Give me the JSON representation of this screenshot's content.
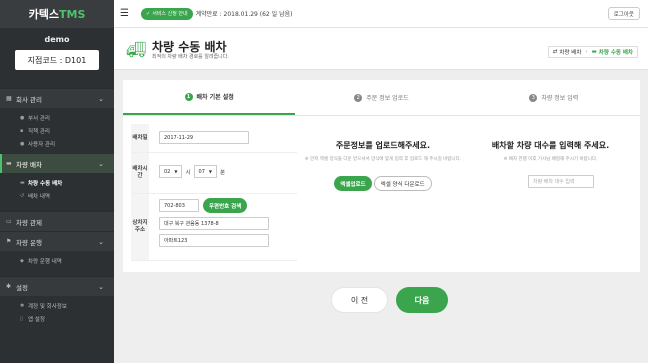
{
  "brand": {
    "name": "카텍스",
    "suffix": "TMS"
  },
  "user": {
    "name": "demo",
    "branch_code": "지점코드 : D101"
  },
  "sidebar": {
    "sections": [
      {
        "label": "회사 관리",
        "icon": "building-icon",
        "items": [
          {
            "label": "부서 관리",
            "icon": "people-icon"
          },
          {
            "label": "직책 관리",
            "icon": "id-card-icon"
          },
          {
            "label": "사용자 관리",
            "icon": "user-icon"
          }
        ]
      },
      {
        "label": "차량 배차",
        "icon": "truck-icon",
        "items": [
          {
            "label": "차량 수동 배차",
            "icon": "truck-icon"
          },
          {
            "label": "배차 내역",
            "icon": "history-icon"
          }
        ]
      },
      {
        "label": "차량 관제",
        "icon": "monitor-icon"
      },
      {
        "label": "차량 운행",
        "icon": "route-icon",
        "items": [
          {
            "label": "차량 운행 내역",
            "icon": "pin-icon"
          }
        ]
      },
      {
        "label": "설정",
        "icon": "gears-icon",
        "items": [
          {
            "label": "계정 및 회사정보",
            "icon": "gear-icon"
          },
          {
            "label": "앱 설정",
            "icon": "phone-icon"
          }
        ]
      }
    ]
  },
  "topbar": {
    "service_badge": "서비스 신청 안내",
    "contract": "계약만료 : 2018.01.29 (62 일 남음)",
    "logout": "로그아웃"
  },
  "header": {
    "title": "차량 수동 배차",
    "subtitle": "최적의 차량 배차 경로를 알려줍니다.",
    "breadcrumb": {
      "parent": "차량 배차",
      "current": "차량 수동 배차"
    }
  },
  "steps": [
    {
      "num": "1",
      "label": "배차 기본 설정"
    },
    {
      "num": "2",
      "label": "주문 정보 업로드"
    },
    {
      "num": "3",
      "label": "차량 정보 입력"
    }
  ],
  "form": {
    "date_label": "배차일",
    "date_value": "2017-11-29",
    "time_label": "배차시간",
    "hour": "02",
    "hour_unit": "시",
    "minute": "07",
    "minute_unit": "분",
    "addr_label": "상차지주소",
    "zip": "702-803",
    "zip_button": "우편번호 검색",
    "addr1": "대구 북구 관음동 1378-8",
    "addr2": "아파트123"
  },
  "upload": {
    "heading": "주문정보를 업로드해주세요.",
    "note": "※ 먼저 엑셀 양식을 다운 받으셔서 양식에 맞게 입력 후 업로드 해 주시길 바랍니다.",
    "upload_button": "엑셀업로드",
    "template_button": "엑셀 양식 다운로드"
  },
  "vehicles": {
    "heading": "배차할 차량 대수를 입력해 주세요.",
    "note": "※ 배차 진행 이후 기사님 배정해 주시기 바랍니다.",
    "placeholder": "차량 배차 대수 입력"
  },
  "nav": {
    "prev": "이 전",
    "next": "다음"
  },
  "colors": {
    "accent": "#3aa54c",
    "sidebar": "#2d3033"
  }
}
